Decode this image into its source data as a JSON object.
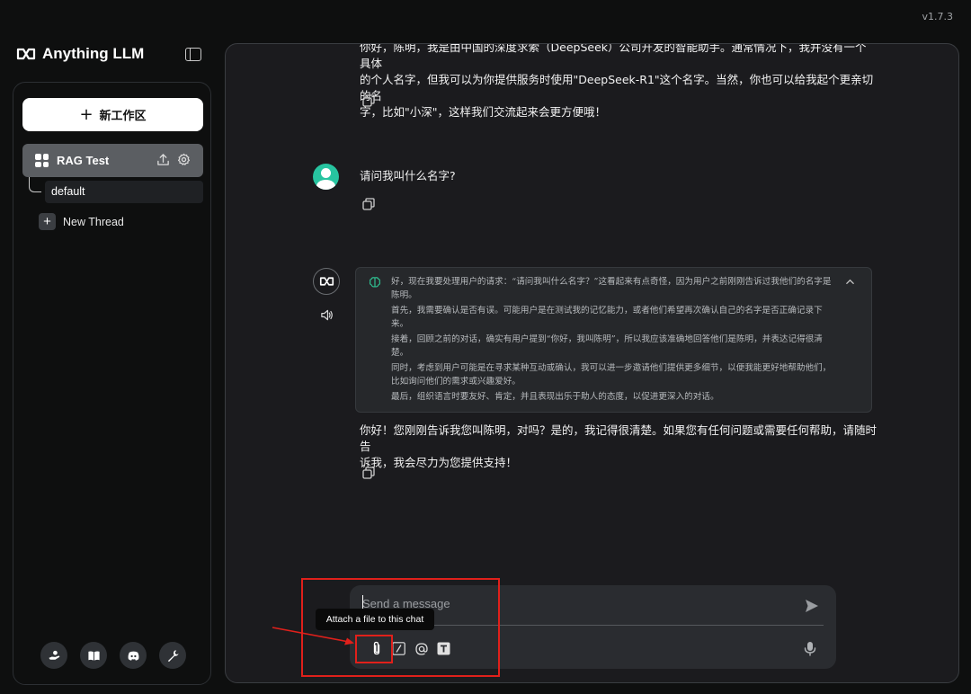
{
  "app": {
    "version": "v1.7.3",
    "brand_name": "Anything LLM"
  },
  "sidebar": {
    "new_workspace_label": "新工作区",
    "workspace": {
      "name": "RAG Test",
      "threads": [
        {
          "label": "default",
          "active": true
        }
      ],
      "new_thread_label": "New Thread"
    },
    "footer_icons": [
      "community-hand-icon",
      "docs-book-icon",
      "discord-icon",
      "wrench-settings-icon"
    ]
  },
  "chat": {
    "prev_assistant_lines": [
      "你好，陈明，我是由中国的深度求索（DeepSeek）公司开发的智能助手。通常情况下，我并没有一个具体",
      "的个人名字，但我可以为你提供服务时使用\"DeepSeek-R1\"这个名字。当然，你也可以给我起个更亲切的名",
      "字，比如\"小深\"，这样我们交流起来会更方便哦！"
    ],
    "user_message": "请问我叫什么名字?",
    "thought_paragraphs": [
      "好，现在我要处理用户的请求：“请问我叫什么名字？”这看起来有点奇怪，因为用户之前刚刚告诉过我他们的名字是陈明。",
      "首先，我需要确认是否有误。可能用户是在测试我的记忆能力，或者他们希望再次确认自己的名字是否正确记录下来。",
      "接着，回顾之前的对话，确实有用户提到“你好，我叫陈明”，所以我应该准确地回答他们是陈明，并表达记得很清楚。",
      "同时，考虑到用户可能是在寻求某种互动或确认，我可以进一步邀请他们提供更多细节，以便我能更好地帮助他们，比如询问他们的需求或兴趣爱好。",
      "最后，组织语言时要友好、肯定，并且表现出乐于助人的态度，以促进更深入的对话。"
    ],
    "assistant_reply_lines": [
      "你好！您刚刚告诉我您叫陈明，对吗？是的，我记得很清楚。如果您有任何问题或需要任何帮助，请随时告",
      "诉我，我会尽力为您提供支持！"
    ]
  },
  "composer": {
    "placeholder": "Send a message",
    "tooltip": "Attach a file to this chat",
    "tools": [
      "paperclip-icon",
      "slash-command-icon",
      "at-mention-icon",
      "text-size-icon"
    ]
  },
  "annotation": {
    "highlight_color": "#e0201b"
  }
}
